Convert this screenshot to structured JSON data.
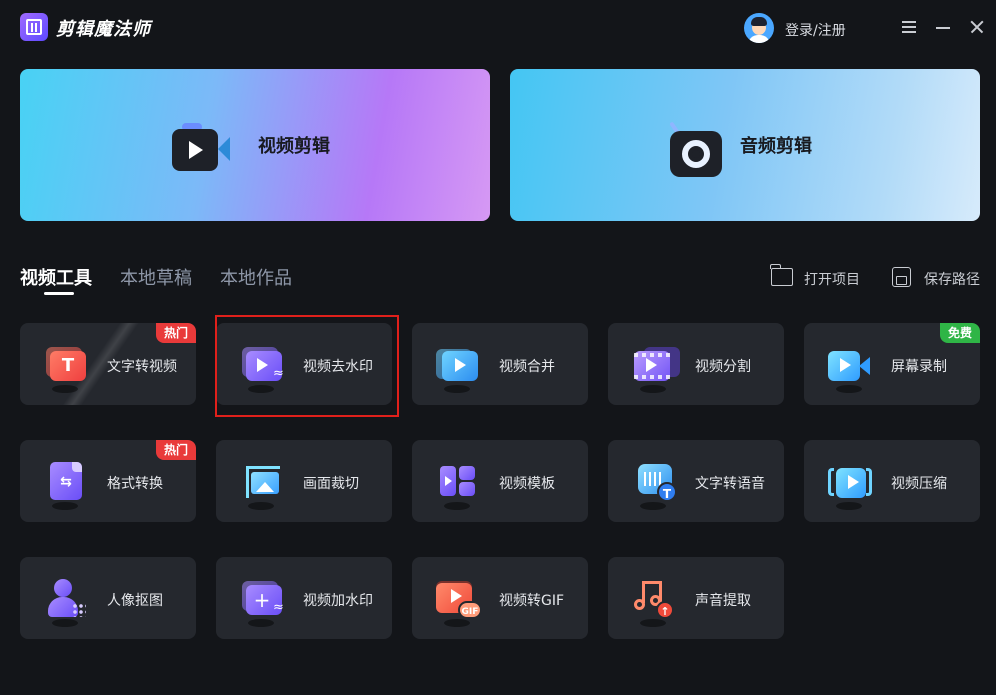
{
  "app": {
    "title": "剪辑魔法师",
    "login_label": "登录/注册"
  },
  "window_controls": [
    "menu",
    "minimize",
    "close"
  ],
  "hero": {
    "video_edit": {
      "label": "视频剪辑",
      "icon": "video-camera-icon"
    },
    "audio_edit": {
      "label": "音频剪辑",
      "icon": "audio-disc-icon"
    }
  },
  "tabs": [
    {
      "label": "视频工具",
      "active": true
    },
    {
      "label": "本地草稿",
      "active": false
    },
    {
      "label": "本地作品",
      "active": false
    }
  ],
  "actions": {
    "open_project": {
      "label": "打开项目",
      "icon": "folder-open-icon"
    },
    "save_path": {
      "label": "保存路径",
      "icon": "save-icon"
    }
  },
  "tools": [
    {
      "label": "文字转视频",
      "icon": "text-to-video-icon",
      "badge": "热门"
    },
    {
      "label": "视频去水印",
      "icon": "remove-watermark-icon",
      "selected": true
    },
    {
      "label": "视频合并",
      "icon": "video-merge-icon"
    },
    {
      "label": "视频分割",
      "icon": "video-split-icon"
    },
    {
      "label": "屏幕录制",
      "icon": "screen-record-icon",
      "badge": "免费"
    },
    {
      "label": "格式转换",
      "icon": "format-convert-icon",
      "badge": "热门"
    },
    {
      "label": "画面裁切",
      "icon": "crop-icon"
    },
    {
      "label": "视频模板",
      "icon": "template-icon"
    },
    {
      "label": "文字转语音",
      "icon": "text-to-speech-icon"
    },
    {
      "label": "视频压缩",
      "icon": "video-compress-icon"
    },
    {
      "label": "人像抠图",
      "icon": "portrait-cutout-icon"
    },
    {
      "label": "视频加水印",
      "icon": "add-watermark-icon"
    },
    {
      "label": "视频转GIF",
      "icon": "video-to-gif-icon"
    },
    {
      "label": "声音提取",
      "icon": "audio-extract-icon"
    }
  ],
  "colors": {
    "background": "#131519",
    "card": "#25282e",
    "hot_badge": "#e93a3a",
    "free_badge": "#2fb546",
    "selection_outline": "#e0201b"
  }
}
